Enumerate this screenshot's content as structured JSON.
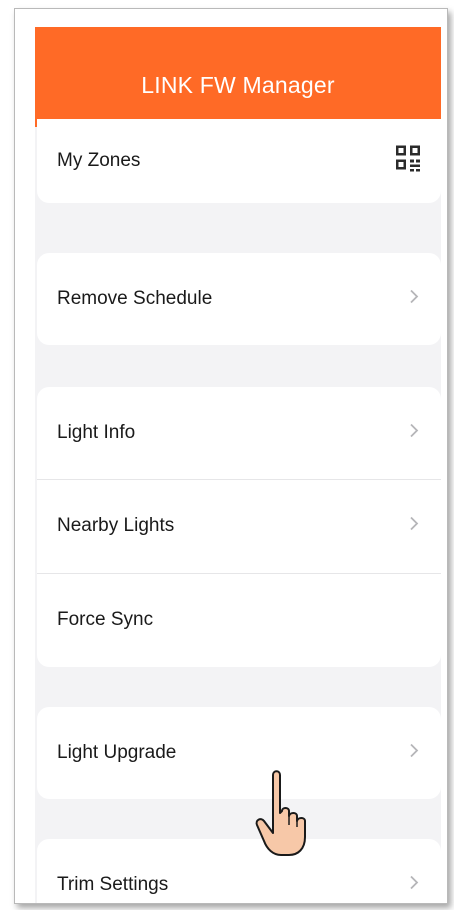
{
  "app": {
    "title": "LINK FW Manager"
  },
  "colors": {
    "header": "#ff6a26",
    "background": "#f3f3f5",
    "chevron": "#b5b5b8"
  },
  "sections": [
    {
      "items": [
        {
          "label": "My Zones",
          "icon": "qr-code-icon"
        }
      ]
    },
    {
      "items": [
        {
          "label": "Remove Schedule",
          "icon": "chevron-right-icon"
        }
      ]
    },
    {
      "items": [
        {
          "label": "Light Info",
          "icon": "chevron-right-icon"
        },
        {
          "label": "Nearby Lights",
          "icon": "chevron-right-icon"
        },
        {
          "label": "Force Sync",
          "icon": ""
        }
      ]
    },
    {
      "items": [
        {
          "label": "Light Upgrade",
          "icon": "chevron-right-icon"
        }
      ]
    },
    {
      "items": [
        {
          "label": "Trim Settings",
          "icon": "chevron-right-icon"
        }
      ]
    }
  ],
  "overlay": {
    "icon": "pointing-hand-icon"
  }
}
